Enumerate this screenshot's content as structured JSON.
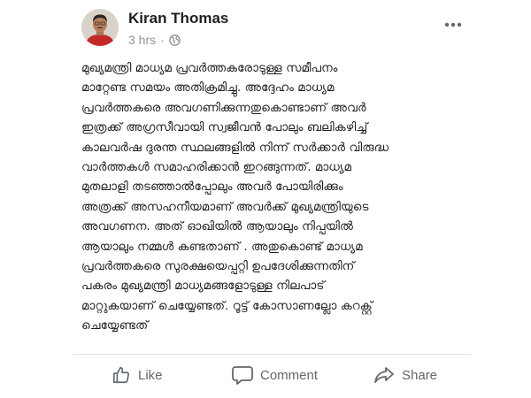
{
  "post": {
    "author": "Kiran Thomas",
    "time": "3 hrs",
    "separator": "·",
    "privacy_icon": "globe-icon",
    "more_icon": "more-options-icon",
    "body_lines": [
      "മുഖ്യമന്ത്രി മാധ്യമ പ്രവർത്തകരോടുള്ള സമീപനം",
      "മാറ്റേണ്ട സമയം അതിക്രമിച്ചു. അദ്ദേഹം മാധ്യമ",
      "പ്രവർത്തകരെ അവഗണിക്കുന്നതുകൊണ്ടാണ് അവർ",
      "ഇത്രക്ക് അഗ്രസീവായി സ്വജീവൻ പോലും ബലികഴിച്ച്",
      "കാലവർഷ ദുരന്ത സ്ഥലങ്ങളിൽ നിന്ന് സർക്കാർ വിരുദ്ധ",
      "വാർത്തകൾ സമാഹരിക്കാൻ ഇറങ്ങുന്നത്. മാധ്യമ",
      "മുതലാളി തടഞ്ഞാൽപ്പോലും അവർ പോയിരിക്കും",
      "അത്രക്ക് അസഹനീയമാണ് അവർക്ക് മുഖ്യമന്ത്രിയുടെ",
      "അവഗണന. അത് ഓഖിയിൽ ആയാലും നിപ്പയിൽ",
      "ആയാലും നമ്മൾ കണ്ടതാണ് . അതുകൊണ്ട് മാധ്യമ",
      "പ്രവർത്തകരെ സുരക്ഷയെപ്പറ്റി ഉപദേശിക്കുന്നതിന്",
      "പകരം മുഖ്യമന്ത്രി മാധ്യമങ്ങളോടുള്ള നിലപാട്",
      "മാറ്റുകയാണ് ചെയ്യേണ്ടത്. റൂട്ട് കോസാണല്ലോ കറക്റ്റ്",
      "ചെയ്യേണ്ടത്"
    ]
  },
  "actions": {
    "like_label": "Like",
    "comment_label": "Comment",
    "share_label": "Share"
  },
  "colors": {
    "text": "#1c1e21",
    "meta": "#8d949e",
    "action": "#606770"
  }
}
